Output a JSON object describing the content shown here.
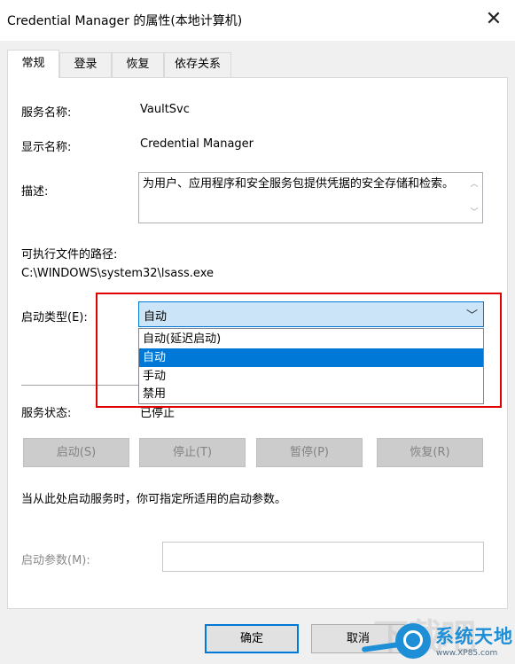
{
  "window": {
    "title": "Credential Manager 的属性(本地计算机)",
    "close_glyph": "✕"
  },
  "tabs": [
    {
      "label": "常规",
      "active": true
    },
    {
      "label": "登录"
    },
    {
      "label": "恢复"
    },
    {
      "label": "依存关系"
    }
  ],
  "general": {
    "service_name_label": "服务名称:",
    "service_name_value": "VaultSvc",
    "display_name_label": "显示名称:",
    "display_name_value": "Credential Manager",
    "description_label": "描述:",
    "description_value": "为用户、应用程序和安全服务包提供凭据的安全存储和检索。",
    "exe_path_label": "可执行文件的路径:",
    "exe_path_value": "C:\\WINDOWS\\system32\\lsass.exe",
    "startup_type_label": "启动类型(E):",
    "startup_type_selected": "自动",
    "startup_type_options": [
      "自动(延迟启动)",
      "自动",
      "手动",
      "禁用"
    ],
    "service_status_label": "服务状态:",
    "service_status_value": "已停止"
  },
  "service_buttons": {
    "start": "启动(S)",
    "stop": "停止(T)",
    "pause": "暂停(P)",
    "resume": "恢复(R)"
  },
  "hint_text": "当从此处启动服务时，你可指定所适用的启动参数。",
  "start_params_label": "启动参数(M):",
  "start_params_value": "",
  "footer": {
    "ok": "确定",
    "cancel": "取消"
  },
  "watermark": {
    "brand": "系统天地",
    "url": "www.XP85.com",
    "ghost_text": "下载吧"
  },
  "colors": {
    "accent": "#0078d7",
    "highlight_box": "#e10000",
    "selection_bg": "#cce4f7"
  }
}
